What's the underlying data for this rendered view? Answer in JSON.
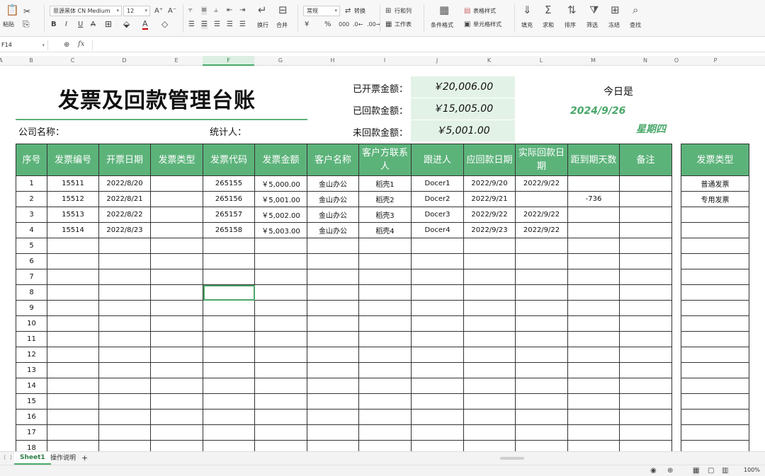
{
  "ribbon": {
    "paste": "粘贴",
    "font_name": "思源黑体 CN Medium",
    "font_size": "12",
    "wrap": "换行",
    "merge": "合并",
    "number_format": "常规",
    "convert": "转换",
    "row_col": "行和列",
    "worksheet": "工作表",
    "cond_format": "条件格式",
    "table_style": "表格样式",
    "cell_style": "单元格样式",
    "fill": "填充",
    "sum": "求和",
    "sort": "排序",
    "filter": "筛选",
    "freeze": "冻结",
    "find": "查找"
  },
  "formula_bar": {
    "cell_ref": "F14",
    "fx": "fx"
  },
  "columns": [
    "A",
    "B",
    "C",
    "D",
    "E",
    "F",
    "G",
    "H",
    "I",
    "J",
    "K",
    "L",
    "M",
    "N",
    "O",
    "P"
  ],
  "sheet": {
    "title": "发票及回款管理台账",
    "company_label": "公司名称：",
    "stats_person_label": "统计人：",
    "invoiced_label": "已开票金额：",
    "invoiced_value": "￥20,006.00",
    "received_label": "已回款金额：",
    "received_value": "￥15,005.00",
    "outstanding_label": "未回款金额：",
    "outstanding_value": "￥5,001.00",
    "today_label": "今日是",
    "today_date": "2024/9/26",
    "weekday": "星期四"
  },
  "table": {
    "headers": [
      "序号",
      "发票编号",
      "开票日期",
      "发票类型",
      "发票代码",
      "发票金额",
      "客户名称",
      "客户方联系人",
      "跟进人",
      "应回款日期",
      "实际回款日期",
      "距到期天数",
      "备注"
    ],
    "rows": [
      [
        "1",
        "15511",
        "2022/8/20",
        "",
        "265155",
        "￥5,000.00",
        "金山办公",
        "稻壳1",
        "Docer1",
        "2022/9/20",
        "2022/9/22",
        "",
        ""
      ],
      [
        "2",
        "15512",
        "2022/8/21",
        "",
        "265156",
        "￥5,001.00",
        "金山办公",
        "稻壳2",
        "Docer2",
        "2022/9/21",
        "",
        "-736",
        ""
      ],
      [
        "3",
        "15513",
        "2022/8/22",
        "",
        "265157",
        "￥5,002.00",
        "金山办公",
        "稻壳3",
        "Docer3",
        "2022/9/22",
        "2022/9/22",
        "",
        ""
      ],
      [
        "4",
        "15514",
        "2022/8/23",
        "",
        "265158",
        "￥5,003.00",
        "金山办公",
        "稻壳4",
        "Docer4",
        "2022/9/23",
        "2022/9/22",
        "",
        ""
      ],
      [
        "5",
        "",
        "",
        "",
        "",
        "",
        "",
        "",
        "",
        "",
        "",
        "",
        ""
      ],
      [
        "6",
        "",
        "",
        "",
        "",
        "",
        "",
        "",
        "",
        "",
        "",
        "",
        ""
      ],
      [
        "7",
        "",
        "",
        "",
        "",
        "",
        "",
        "",
        "",
        "",
        "",
        "",
        ""
      ],
      [
        "8",
        "",
        "",
        "",
        "",
        "",
        "",
        "",
        "",
        "",
        "",
        "",
        ""
      ],
      [
        "9",
        "",
        "",
        "",
        "",
        "",
        "",
        "",
        "",
        "",
        "",
        "",
        ""
      ],
      [
        "10",
        "",
        "",
        "",
        "",
        "",
        "",
        "",
        "",
        "",
        "",
        "",
        ""
      ],
      [
        "11",
        "",
        "",
        "",
        "",
        "",
        "",
        "",
        "",
        "",
        "",
        "",
        ""
      ],
      [
        "12",
        "",
        "",
        "",
        "",
        "",
        "",
        "",
        "",
        "",
        "",
        "",
        ""
      ],
      [
        "13",
        "",
        "",
        "",
        "",
        "",
        "",
        "",
        "",
        "",
        "",
        "",
        ""
      ],
      [
        "14",
        "",
        "",
        "",
        "",
        "",
        "",
        "",
        "",
        "",
        "",
        "",
        ""
      ],
      [
        "15",
        "",
        "",
        "",
        "",
        "",
        "",
        "",
        "",
        "",
        "",
        "",
        ""
      ],
      [
        "16",
        "",
        "",
        "",
        "",
        "",
        "",
        "",
        "",
        "",
        "",
        "",
        ""
      ],
      [
        "17",
        "",
        "",
        "",
        "",
        "",
        "",
        "",
        "",
        "",
        "",
        "",
        ""
      ],
      [
        "18",
        "",
        "",
        "",
        "",
        "",
        "",
        "",
        "",
        "",
        "",
        "",
        ""
      ]
    ]
  },
  "side_table": {
    "header": "发票类型",
    "values": [
      "普通发票",
      "专用发票",
      "",
      "",
      "",
      "",
      "",
      "",
      "",
      "",
      "",
      "",
      "",
      "",
      "",
      "",
      "",
      ""
    ]
  },
  "tabs": {
    "active": "Sheet1",
    "second": "操作说明",
    "add": "+"
  },
  "status": {
    "zoom": "100%"
  }
}
